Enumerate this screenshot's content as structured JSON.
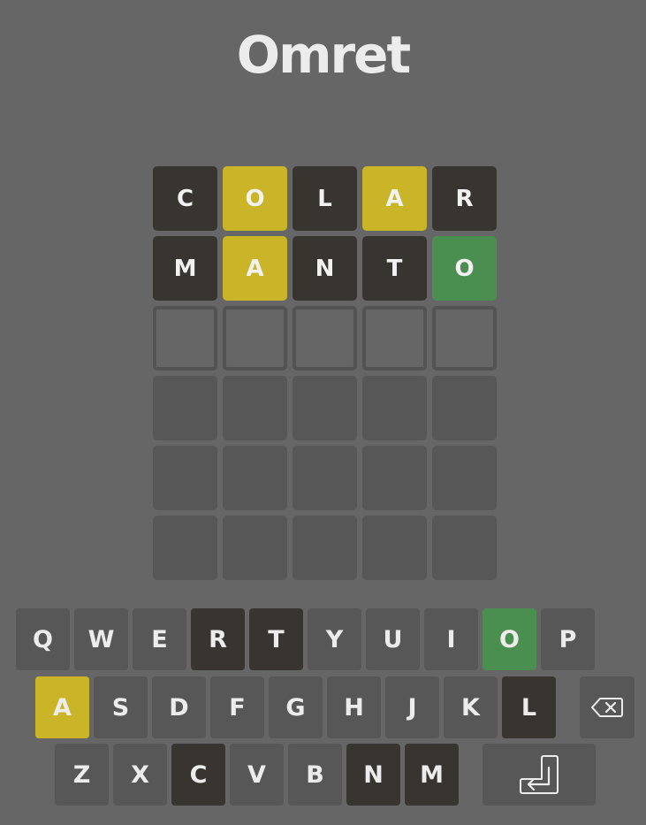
{
  "app": {
    "title": "Omret"
  },
  "colors": {
    "background": "#666666",
    "absent": "#38342f",
    "present": "#c9b527",
    "correct": "#4a8f50",
    "empty": "#575757",
    "text": "#ececec"
  },
  "board": {
    "rows": [
      {
        "tiles": [
          {
            "letter": "C",
            "state": "absent"
          },
          {
            "letter": "O",
            "state": "present"
          },
          {
            "letter": "L",
            "state": "absent"
          },
          {
            "letter": "A",
            "state": "present"
          },
          {
            "letter": "R",
            "state": "absent"
          }
        ]
      },
      {
        "tiles": [
          {
            "letter": "M",
            "state": "absent"
          },
          {
            "letter": "A",
            "state": "present"
          },
          {
            "letter": "N",
            "state": "absent"
          },
          {
            "letter": "T",
            "state": "absent"
          },
          {
            "letter": "O",
            "state": "correct"
          }
        ]
      },
      {
        "tiles": [
          {
            "letter": "",
            "state": "active"
          },
          {
            "letter": "",
            "state": "active"
          },
          {
            "letter": "",
            "state": "active"
          },
          {
            "letter": "",
            "state": "active"
          },
          {
            "letter": "",
            "state": "active"
          }
        ]
      },
      {
        "tiles": [
          {
            "letter": "",
            "state": "empty"
          },
          {
            "letter": "",
            "state": "empty"
          },
          {
            "letter": "",
            "state": "empty"
          },
          {
            "letter": "",
            "state": "empty"
          },
          {
            "letter": "",
            "state": "empty"
          }
        ]
      },
      {
        "tiles": [
          {
            "letter": "",
            "state": "empty"
          },
          {
            "letter": "",
            "state": "empty"
          },
          {
            "letter": "",
            "state": "empty"
          },
          {
            "letter": "",
            "state": "empty"
          },
          {
            "letter": "",
            "state": "empty"
          }
        ]
      },
      {
        "tiles": [
          {
            "letter": "",
            "state": "empty"
          },
          {
            "letter": "",
            "state": "empty"
          },
          {
            "letter": "",
            "state": "empty"
          },
          {
            "letter": "",
            "state": "empty"
          },
          {
            "letter": "",
            "state": "empty"
          }
        ]
      }
    ]
  },
  "keyboard": {
    "rows": [
      {
        "keys": [
          {
            "label": "Q",
            "state": "unused"
          },
          {
            "label": "W",
            "state": "unused"
          },
          {
            "label": "E",
            "state": "unused"
          },
          {
            "label": "R",
            "state": "absent"
          },
          {
            "label": "T",
            "state": "absent"
          },
          {
            "label": "Y",
            "state": "unused"
          },
          {
            "label": "U",
            "state": "unused"
          },
          {
            "label": "I",
            "state": "unused"
          },
          {
            "label": "O",
            "state": "correct"
          },
          {
            "label": "P",
            "state": "unused"
          }
        ]
      },
      {
        "keys": [
          {
            "label": "A",
            "state": "present"
          },
          {
            "label": "S",
            "state": "unused"
          },
          {
            "label": "D",
            "state": "unused"
          },
          {
            "label": "F",
            "state": "unused"
          },
          {
            "label": "G",
            "state": "unused"
          },
          {
            "label": "H",
            "state": "unused"
          },
          {
            "label": "J",
            "state": "unused"
          },
          {
            "label": "K",
            "state": "unused"
          },
          {
            "label": "L",
            "state": "absent"
          },
          {
            "label": "",
            "icon": "backspace-icon",
            "state": "unused"
          }
        ]
      },
      {
        "keys": [
          {
            "label": "Z",
            "state": "unused"
          },
          {
            "label": "X",
            "state": "unused"
          },
          {
            "label": "C",
            "state": "absent"
          },
          {
            "label": "V",
            "state": "unused"
          },
          {
            "label": "B",
            "state": "unused"
          },
          {
            "label": "N",
            "state": "absent"
          },
          {
            "label": "M",
            "state": "absent"
          },
          {
            "label": "",
            "icon": "enter-icon",
            "state": "unused"
          }
        ]
      }
    ]
  }
}
